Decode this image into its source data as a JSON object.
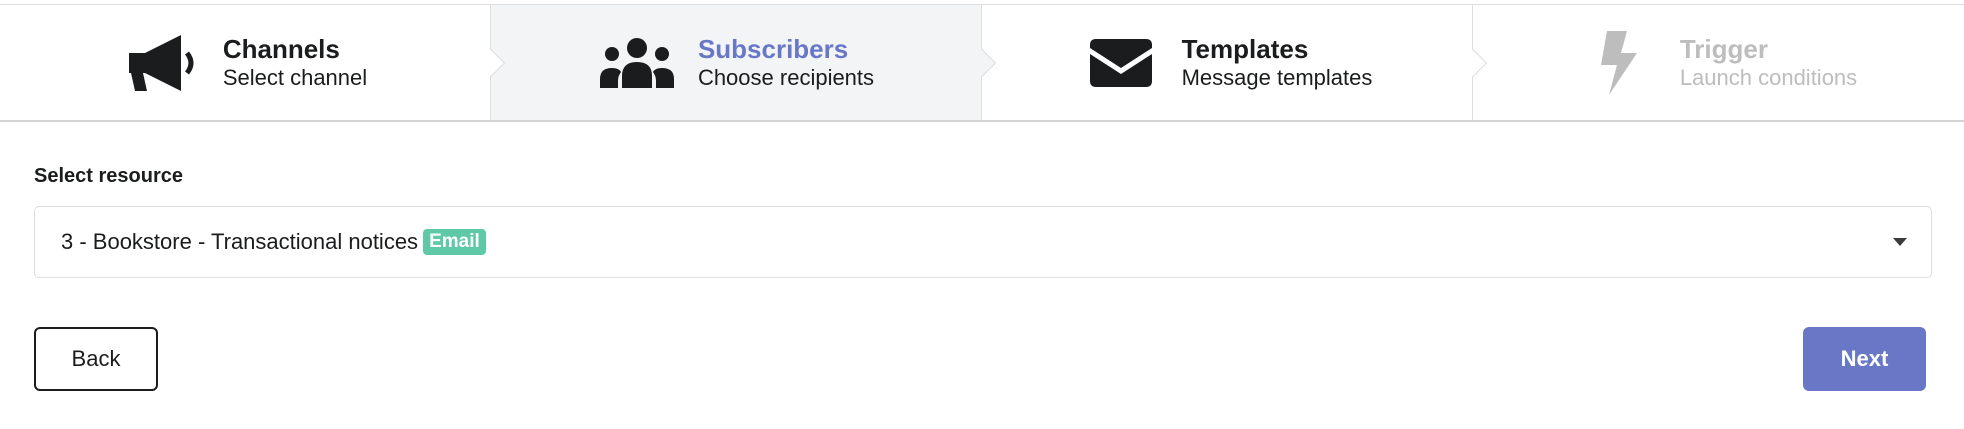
{
  "steps": [
    {
      "title": "Channels",
      "description": "Select channel",
      "icon": "megaphone-icon",
      "state": "completed"
    },
    {
      "title": "Subscribers",
      "description": "Choose recipients",
      "icon": "users-icon",
      "state": "active"
    },
    {
      "title": "Templates",
      "description": "Message templates",
      "icon": "envelope-icon",
      "state": "completed"
    },
    {
      "title": "Trigger",
      "description": "Launch conditions",
      "icon": "bolt-icon",
      "state": "disabled"
    }
  ],
  "form": {
    "label": "Select resource",
    "selected_value": "3 - Bookstore - Transactional notices",
    "selected_badge": "Email"
  },
  "actions": {
    "back_label": "Back",
    "next_label": "Next"
  },
  "colors": {
    "accent": "#6977c7",
    "badge": "#5fc9a7",
    "active_step_bg": "#f3f4f5",
    "disabled_text": "#bdbdbd"
  }
}
